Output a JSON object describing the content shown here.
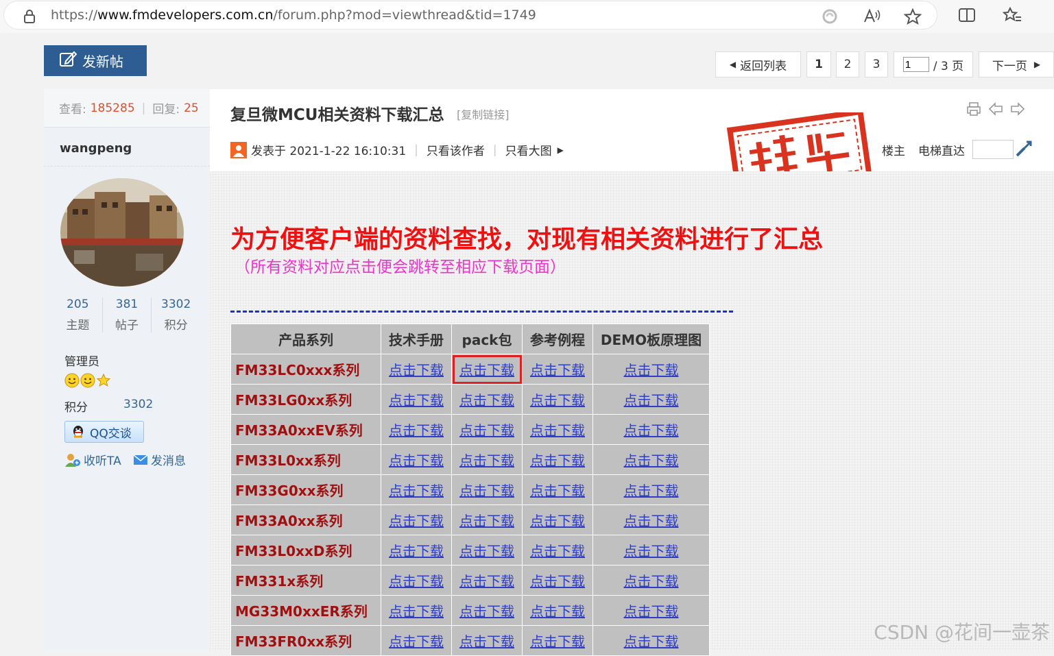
{
  "browser": {
    "url_prefix": "https://",
    "url_domain": "www.fmdevelopers.com.cn",
    "url_path": "/forum.php?mod=viewthread&tid=1749"
  },
  "toolbar": {
    "post_label": "发新帖"
  },
  "pager": {
    "back_label": "返回列表",
    "pages": [
      "1",
      "2",
      "3"
    ],
    "current_input": "1",
    "total_label": "/ 3 页",
    "next_label": "下一页"
  },
  "thread_stats": {
    "views_label": "查看:",
    "views": "185285",
    "sep": "|",
    "replies_label": "回复:",
    "replies": "25"
  },
  "author": {
    "name": "wangpeng",
    "topics": "205",
    "topics_label": "主题",
    "posts": "381",
    "posts_label": "帖子",
    "points": "3302",
    "points_label": "积分",
    "role": "管理员",
    "score_label": "积分",
    "score": "3302",
    "qq_label": "QQ交谈",
    "follow_label": "收听TA",
    "message_label": "发消息"
  },
  "post": {
    "title": "复旦微MCU相关资料下载汇总",
    "copy_link": "[复制链接]",
    "posted": "发表于 2021-1-22 16:10:31",
    "only_author": "只看该作者",
    "only_large": "只看大图",
    "floor": "楼主",
    "elevator": "电梯直达",
    "stamp_text": "精华",
    "headline": "为方便客户端的资料查找，对现有相关资料进行了汇总",
    "subline": "（所有资料对应点击便会跳转至相应下载页面）"
  },
  "table": {
    "headers": [
      "产品系列",
      "技术手册",
      "pack包",
      "参考例程",
      "DEMO板原理图"
    ],
    "link_text": "点击下载",
    "rows": [
      "FM33LC0xxx系列",
      "FM33LG0xx系列",
      "FM33A0xxEV系列",
      "FM33L0xx系列",
      "FM33G0xx系列",
      "FM33A0xx系列",
      "FM33L0xxD系列",
      "FM331x系列",
      "MG33M0xxER系列",
      "FM33FR0xx系列"
    ]
  },
  "watermark": "CSDN @花间一壶茶",
  "colors": {
    "accent": "#2e5d94",
    "headline": "#ee1111",
    "subline": "#ee33cc",
    "series": "#a01010",
    "link": "#2f3ec9",
    "highlight": "#e02020"
  }
}
